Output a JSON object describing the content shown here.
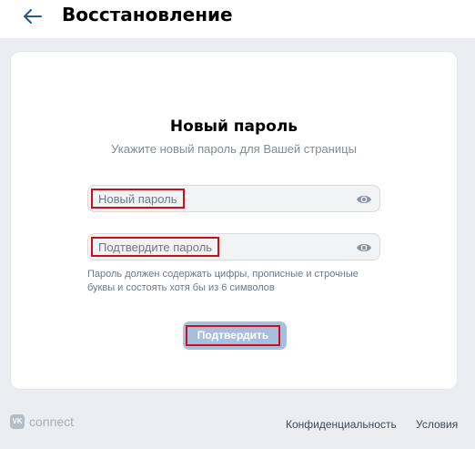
{
  "header": {
    "title": "Восстановление",
    "back_icon": "arrow-left-icon",
    "accent": "#2a5885"
  },
  "form": {
    "title": "Новый пароль",
    "subtitle": "Укажите новый пароль для Вашей страницы",
    "new_password": {
      "placeholder": "Новый пароль",
      "value": "",
      "icon": "eye-icon"
    },
    "confirm_password": {
      "placeholder": "Подтвердите пароль",
      "value": "",
      "icon": "eye-icon"
    },
    "hint": "Пароль должен содержать цифры, прописные и строчные буквы и состоять хотя бы из 6 символов",
    "submit_label": "Подтвердить",
    "highlight_color": "#c8101e",
    "button_color": "#a7bfdd"
  },
  "footer": {
    "logo_text": "connect",
    "logo_mark": "VK",
    "privacy_label": "Конфиденциальность",
    "terms_label": "Условия"
  }
}
